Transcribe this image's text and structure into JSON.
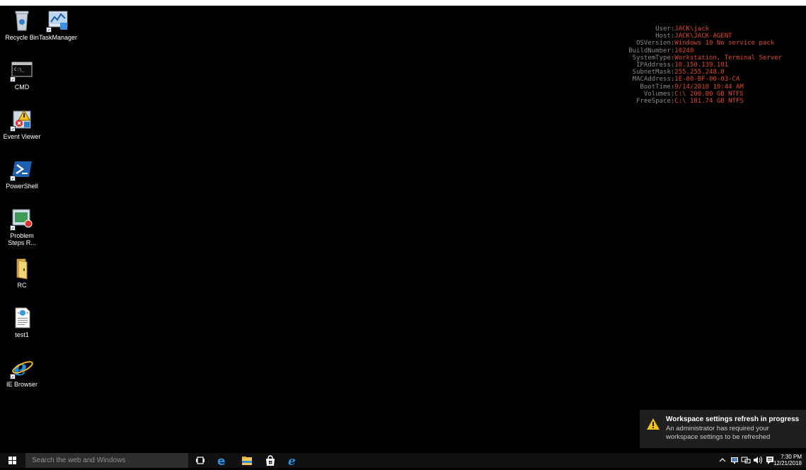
{
  "desktop": {
    "icons": [
      {
        "label": "Recycle Bin",
        "icon": "recycle-bin-icon"
      },
      {
        "label": "TaskManager",
        "icon": "task-manager-icon"
      },
      {
        "label": "CMD",
        "icon": "cmd-icon"
      },
      {
        "label": "Event Viewer",
        "icon": "event-viewer-icon"
      },
      {
        "label": "PowerShell",
        "icon": "powershell-icon"
      },
      {
        "label": "Problem Steps R...",
        "icon": "problem-steps-recorder-icon"
      },
      {
        "label": "RC",
        "icon": "folder-icon"
      },
      {
        "label": "test1",
        "icon": "html-file-icon"
      },
      {
        "label": "IE Browser",
        "icon": "ie-icon"
      }
    ]
  },
  "sysinfo": [
    {
      "key": "User:",
      "value": "JACK\\jack"
    },
    {
      "key": "Host:",
      "value": "JACK\\JACK-AGENT"
    },
    {
      "key": "OSVersion:",
      "value": "Windows 10 No service pack"
    },
    {
      "key": "BuildNumber:",
      "value": "10240"
    },
    {
      "key": "SystemType:",
      "value": "Workstation, Terminal Server"
    },
    {
      "key": "IPAddress:",
      "value": "10.150.139.101"
    },
    {
      "key": "SubnetMask:",
      "value": "255.255.248.0"
    },
    {
      "key": "MACAddress:",
      "value": "1E-00-BF-00-03-CA"
    },
    {
      "key": "BootTime:",
      "value": "9/14/2018 10:44 AM"
    },
    {
      "key": "Volumes:",
      "value": "C:\\ 200.00 GB NTFS"
    },
    {
      "key": "FreeSpace:",
      "value": "C:\\ 181.74 GB NTFS"
    }
  ],
  "notification": {
    "title": "Workspace settings refresh in progress",
    "body": "An administrator has required your workspace settings to be refreshed",
    "icon": "warning-icon"
  },
  "taskbar": {
    "search_placeholder": "Search the web and Windows",
    "apps": [
      "task-view-icon",
      "edge-icon",
      "file-explorer-icon",
      "store-icon",
      "ie-icon"
    ],
    "tray": [
      "chevron-up-icon",
      "network-icon",
      "display-icon",
      "volume-icon",
      "action-center-icon"
    ],
    "time": "7:30 PM",
    "date": "12/21/2018"
  },
  "colors": {
    "sysinfo_value": "#e0482f",
    "sysinfo_key": "#8a8a8a",
    "taskbar": "#101010",
    "desktop": "#000000"
  }
}
